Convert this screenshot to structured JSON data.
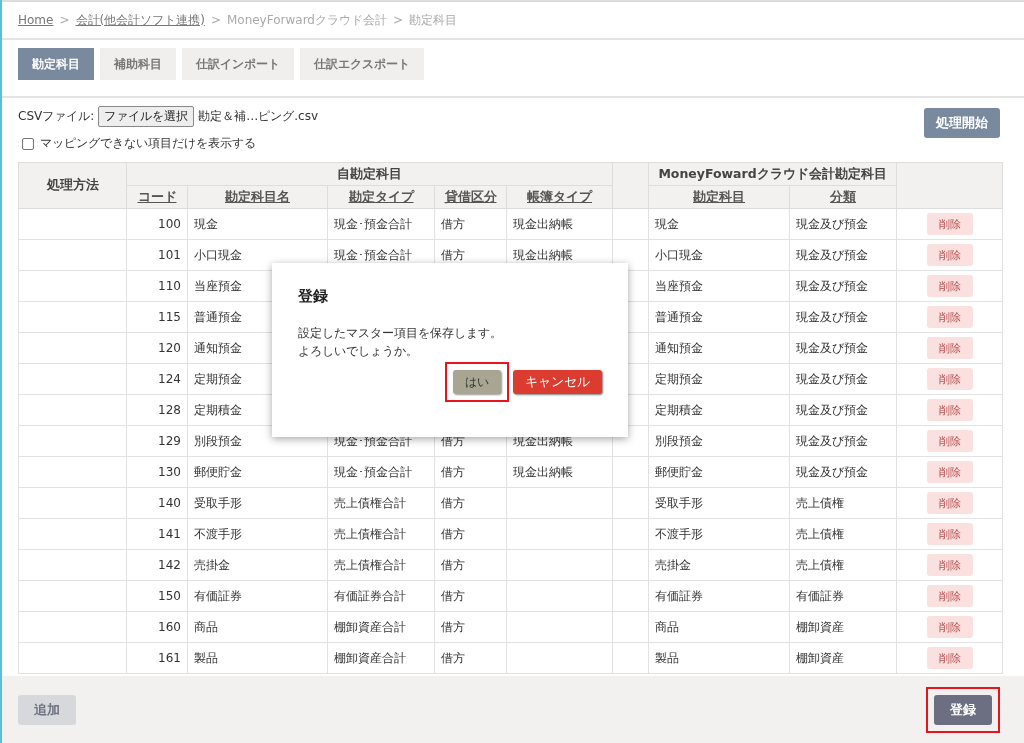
{
  "breadcrumb": [
    {
      "label": "Home",
      "link": true
    },
    {
      "label": "会計(他会計ソフト連携)",
      "link": true
    },
    {
      "label": "MoneyForwardクラウド会計",
      "link": false
    },
    {
      "label": "勘定科目",
      "link": false
    }
  ],
  "breadcrumb_separator": ">",
  "tabs": [
    {
      "label": "勘定科目",
      "selected": true
    },
    {
      "label": "補助科目",
      "selected": false
    },
    {
      "label": "仕訳インポート",
      "selected": false
    },
    {
      "label": "仕訳エクスポート",
      "selected": false
    }
  ],
  "csv": {
    "label": "CSVファイル:",
    "button": "ファイルを選択",
    "filename": "勘定＆補…ピング.csv"
  },
  "filter": {
    "label": "マッピングできない項目だけを表示する",
    "checked": false
  },
  "start_button": "処理開始",
  "table": {
    "method_header": "処理方法",
    "own_group": "自勘定科目",
    "mf_group": "MoneyFowardクラウド会計勘定科目",
    "own_columns": [
      "コード",
      "勘定科目名",
      "勘定タイプ",
      "貸借区分",
      "帳簿タイプ"
    ],
    "mf_columns": [
      "勘定科目",
      "分類"
    ],
    "rows": [
      {
        "code": "100",
        "name": "現金",
        "type": "現金･預金合計",
        "side": "借方",
        "ledger": "現金出納帳",
        "mf_account": "現金",
        "mf_class": "現金及び預金",
        "delete": "削除"
      },
      {
        "code": "101",
        "name": "小口現金",
        "type": "現金･預金合計",
        "side": "借方",
        "ledger": "現金出納帳",
        "mf_account": "小口現金",
        "mf_class": "現金及び預金",
        "delete": "削除"
      },
      {
        "code": "110",
        "name": "当座預金",
        "mf_account": "当座預金",
        "mf_class": "現金及び預金",
        "delete": "削除"
      },
      {
        "code": "115",
        "name": "普通預金",
        "mf_account": "普通預金",
        "mf_class": "現金及び預金",
        "delete": "削除"
      },
      {
        "code": "120",
        "name": "通知預金",
        "mf_account": "通知預金",
        "mf_class": "現金及び預金",
        "delete": "削除"
      },
      {
        "code": "124",
        "name": "定期預金",
        "mf_account": "定期預金",
        "mf_class": "現金及び預金",
        "delete": "削除"
      },
      {
        "code": "128",
        "name": "定期積金",
        "mf_account": "定期積金",
        "mf_class": "現金及び預金",
        "delete": "削除"
      },
      {
        "code": "129",
        "name": "別段預金",
        "type": "現金･預金合計",
        "side": "借方",
        "ledger": "現金出納帳",
        "mf_account": "別段預金",
        "mf_class": "現金及び預金",
        "delete": "削除"
      },
      {
        "code": "130",
        "name": "郵便貯金",
        "type": "現金･預金合計",
        "side": "借方",
        "ledger": "現金出納帳",
        "mf_account": "郵便貯金",
        "mf_class": "現金及び預金",
        "delete": "削除"
      },
      {
        "code": "140",
        "name": "受取手形",
        "type": "売上債権合計",
        "side": "借方",
        "mf_account": "受取手形",
        "mf_class": "売上債権",
        "delete": "削除"
      },
      {
        "code": "141",
        "name": "不渡手形",
        "type": "売上債権合計",
        "side": "借方",
        "mf_account": "不渡手形",
        "mf_class": "売上債権",
        "delete": "削除"
      },
      {
        "code": "142",
        "name": "売掛金",
        "type": "売上債権合計",
        "side": "借方",
        "mf_account": "売掛金",
        "mf_class": "売上債権",
        "delete": "削除"
      },
      {
        "code": "150",
        "name": "有価証券",
        "type": "有価証券合計",
        "side": "借方",
        "mf_account": "有価証券",
        "mf_class": "有価証券",
        "delete": "削除"
      },
      {
        "code": "160",
        "name": "商品",
        "type": "棚卸資産合計",
        "side": "借方",
        "mf_account": "商品",
        "mf_class": "棚卸資産",
        "delete": "削除"
      },
      {
        "code": "161",
        "name": "製品",
        "type": "棚卸資産合計",
        "side": "借方",
        "mf_account": "製品",
        "mf_class": "棚卸資産",
        "delete": "削除"
      }
    ]
  },
  "footer": {
    "add_button": {
      "label": "追加",
      "disabled": true
    },
    "register_button": {
      "label": "登録",
      "highlighted": true
    }
  },
  "dialog": {
    "title": "登録",
    "message": [
      "設定したマスター項目を保存します。",
      "よろしいでしょうか。"
    ],
    "yes_button": {
      "label": "はい",
      "highlighted": true
    },
    "cancel_button": {
      "label": "キャンセル",
      "highlighted": false
    }
  }
}
